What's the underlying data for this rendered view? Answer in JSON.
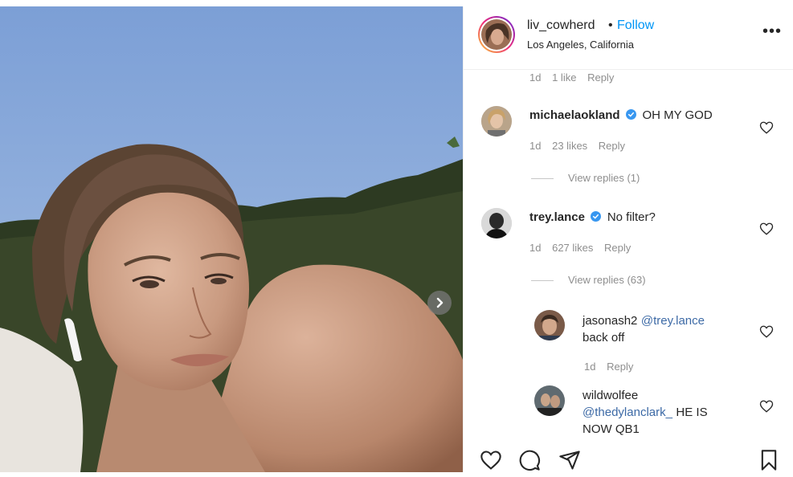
{
  "post": {
    "username": "liv_cowherd",
    "separator": "•",
    "follow_label": "Follow",
    "location": "Los Angeles, California",
    "more_label": "•••"
  },
  "top_meta": {
    "time": "1d",
    "likes": "1 like",
    "reply": "Reply"
  },
  "comments": [
    {
      "username": "michaelaokland",
      "verified": true,
      "text": "OH MY GOD",
      "time": "1d",
      "likes": "23 likes",
      "reply": "Reply",
      "view_replies": "View replies (1)"
    },
    {
      "username": "trey.lance",
      "verified": true,
      "text": "No filter?",
      "time": "1d",
      "likes": "627 likes",
      "reply": "Reply",
      "view_replies": "View replies (63)"
    }
  ],
  "replies": [
    {
      "username": "jasonash2",
      "mention": "@trey.lance",
      "text_line2": "back off",
      "time": "1d",
      "reply": "Reply"
    },
    {
      "username": "wildwolfee",
      "mention": "@thedylanclark_",
      "text": "HE IS",
      "text_line2": "NOW QB1"
    }
  ],
  "colors": {
    "follow": "#0095f6",
    "verified": "#3897f0",
    "muted": "#8e8e8e"
  }
}
